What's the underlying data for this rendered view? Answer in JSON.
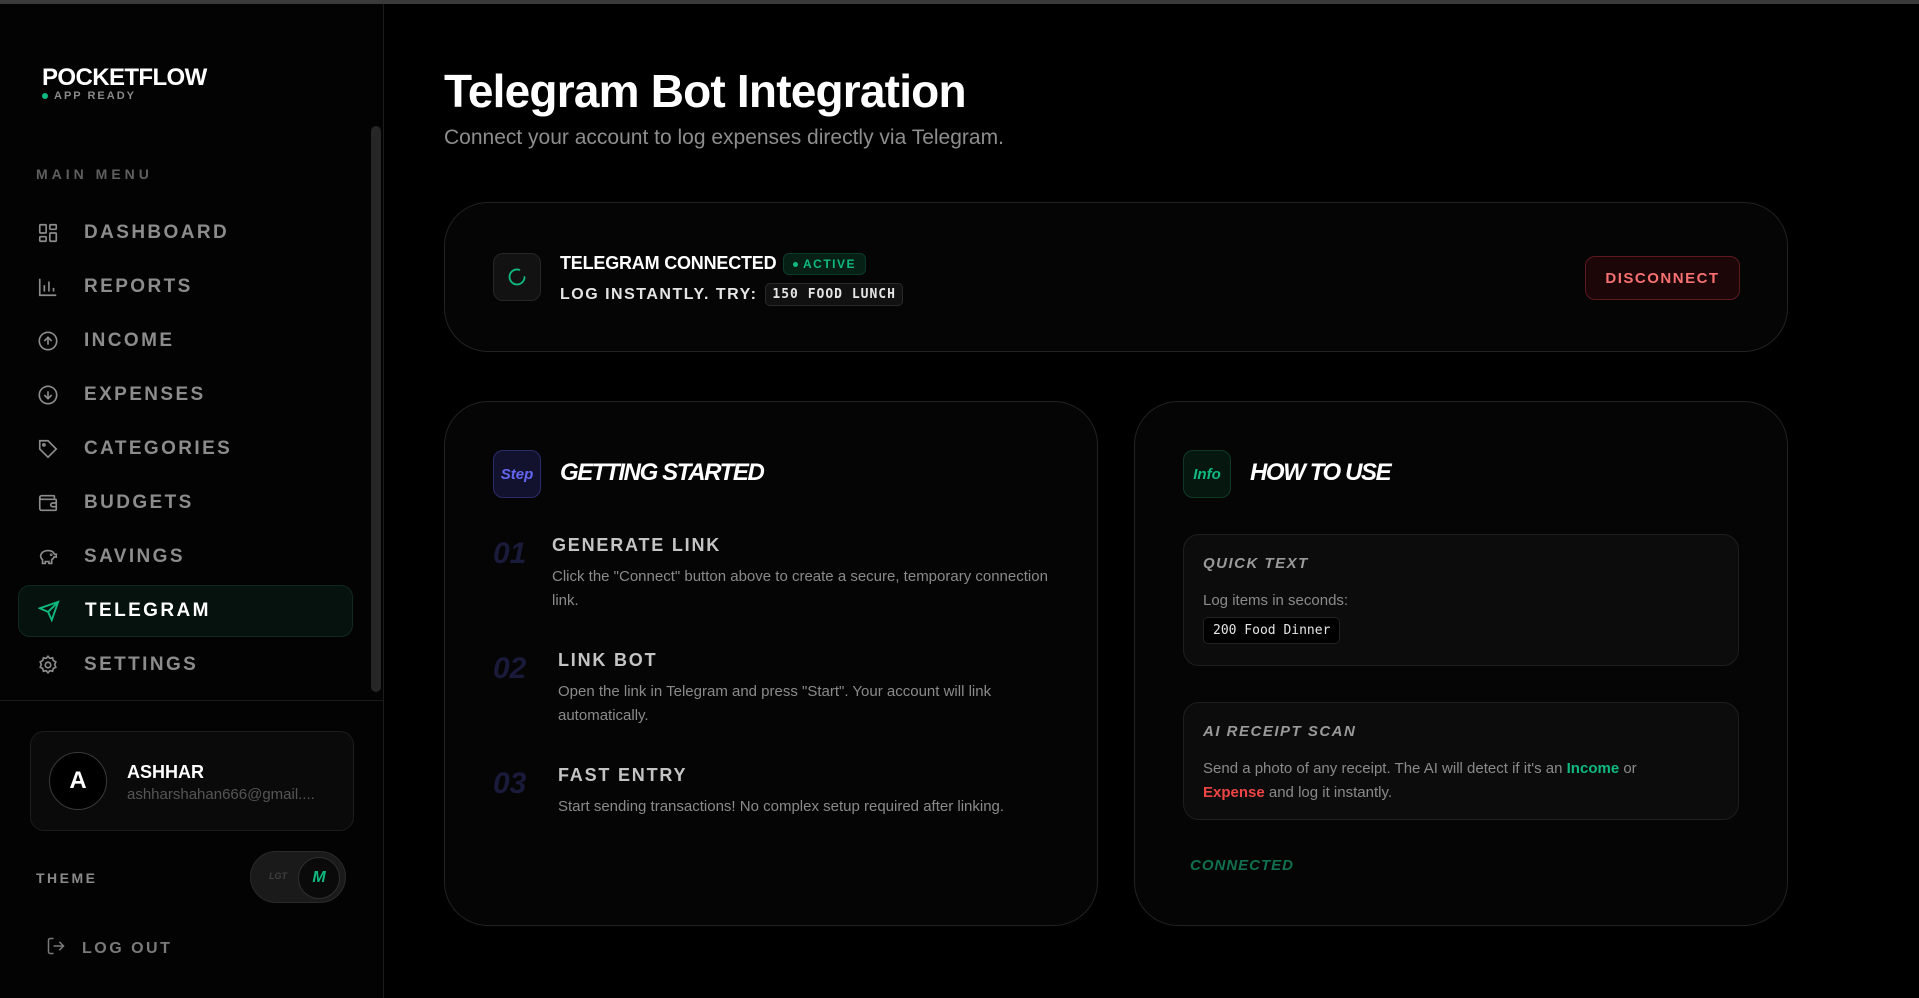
{
  "app": {
    "logo": "POCKETFLOW",
    "status": "APP READY"
  },
  "sidebar": {
    "menu_title": "MAIN MENU",
    "items": [
      {
        "label": "DASHBOARD",
        "icon": "grid-icon"
      },
      {
        "label": "REPORTS",
        "icon": "bar-chart-icon"
      },
      {
        "label": "INCOME",
        "icon": "arrow-up-circle-icon"
      },
      {
        "label": "EXPENSES",
        "icon": "arrow-down-circle-icon"
      },
      {
        "label": "CATEGORIES",
        "icon": "tag-icon"
      },
      {
        "label": "BUDGETS",
        "icon": "wallet-icon"
      },
      {
        "label": "SAVINGS",
        "icon": "piggy-bank-icon"
      },
      {
        "label": "TELEGRAM",
        "icon": "send-icon",
        "active": true
      },
      {
        "label": "SETTINGS",
        "icon": "gear-icon"
      }
    ],
    "user": {
      "initial": "A",
      "name": "ASHHAR",
      "email": "ashharshahan666@gmail...."
    },
    "theme": {
      "label": "THEME",
      "off_label": "LGT",
      "on_label": "M"
    },
    "logout_label": "LOG OUT"
  },
  "header": {
    "title": "Telegram Bot Integration",
    "subtitle": "Connect your account to log expenses directly via Telegram."
  },
  "connection": {
    "title": "TELEGRAM CONNECTED",
    "badge": "ACTIVE",
    "hint_prefix": "LOG INSTANTLY. TRY:",
    "hint_code": "150 FOOD LUNCH",
    "disconnect_label": "DISCONNECT"
  },
  "getting_started": {
    "tag": "Step",
    "title": "GETTING STARTED",
    "steps": [
      {
        "num": "01",
        "title": "GENERATE LINK",
        "desc": "Click the \"Connect\" button above to create a secure, temporary connection link."
      },
      {
        "num": "02",
        "title": "LINK BOT",
        "desc": "Open the link in Telegram and press \"Start\". Your account will link automatically."
      },
      {
        "num": "03",
        "title": "FAST ENTRY",
        "desc": "Start sending transactions! No complex setup required after linking."
      }
    ]
  },
  "how_to_use": {
    "tag": "Info",
    "title": "HOW TO USE",
    "quick_text": {
      "title": "QUICK TEXT",
      "text": "Log items in seconds:",
      "code": "200 Food Dinner"
    },
    "receipt_scan": {
      "title": "AI RECEIPT SCAN",
      "text_1": "Send a photo of any receipt. The AI will detect if it's an ",
      "income": "Income",
      "text_2": " or",
      "expense": "Expense",
      "text_3": " and log it instantly."
    },
    "status": "CONNECTED"
  },
  "colors": {
    "accent": "#10b981",
    "danger": "#ef4444",
    "step_accent": "#6366f1"
  }
}
